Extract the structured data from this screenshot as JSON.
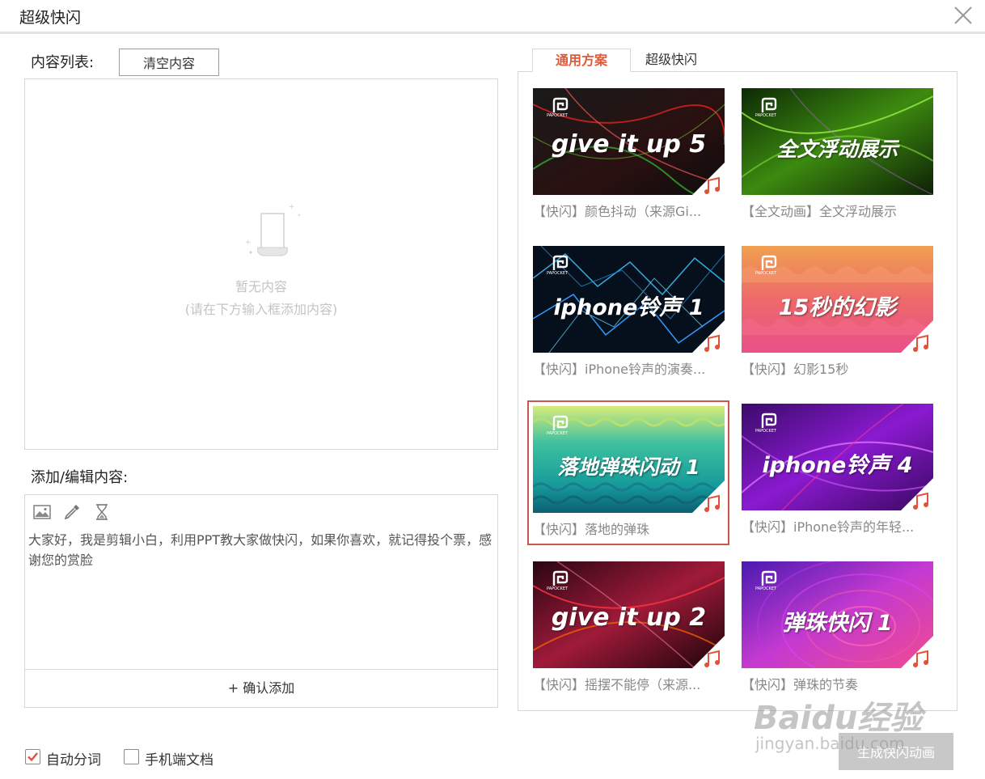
{
  "window": {
    "title": "超级快闪"
  },
  "content_list": {
    "label": "内容列表:",
    "clear_button": "清空内容",
    "empty_title": "暂无内容",
    "empty_hint": "(请在下方输入框添加内容)"
  },
  "editor": {
    "label": "添加/编辑内容:",
    "text": "大家好，我是剪辑小白，利用PPT教大家做快闪，如果你喜欢，就记得投个票，感谢您的赏脸",
    "confirm_button": "+ 确认添加",
    "tools": [
      "image-icon",
      "eyedropper-icon",
      "hourglass-icon"
    ]
  },
  "options": {
    "auto_segment": {
      "label": "自动分词",
      "checked": true
    },
    "mobile_doc": {
      "label": "手机端文档",
      "checked": false
    }
  },
  "tabs": [
    {
      "label": "通用方案",
      "active": true
    },
    {
      "label": "超级快闪",
      "active": false
    }
  ],
  "schemes": [
    {
      "thumb_text": "give it up 5",
      "caption": "【快闪】颜色抖动（来源Gi...",
      "selected": false
    },
    {
      "thumb_text": "全文浮动展示",
      "caption": "【全文动画】全文浮动展示",
      "selected": false
    },
    {
      "thumb_text": "iphone铃声 1",
      "caption": "【快闪】iPhone铃声的演奏...",
      "selected": false
    },
    {
      "thumb_text": "15秒的幻影",
      "caption": "【快闪】幻影15秒",
      "selected": false
    },
    {
      "thumb_text": "落地弹珠闪动 1",
      "caption": "【快闪】落地的弹珠",
      "selected": true
    },
    {
      "thumb_text": "iphone铃声 4",
      "caption": "【快闪】iPhone铃声的年轻...",
      "selected": false
    },
    {
      "thumb_text": "give it up 2",
      "caption": "【快闪】摇摆不能停（来源...",
      "selected": false
    },
    {
      "thumb_text": "弹珠快闪 1",
      "caption": "【快闪】弹珠的节奏",
      "selected": false
    }
  ],
  "brand": {
    "thumb_logo_text": "PAPOCKET"
  },
  "generate_button": "生成快闪动画",
  "watermark": {
    "main": "Baidu经验",
    "sub": "jingyan.baidu.com"
  },
  "colors": {
    "accent": "#e05a3a",
    "selected_border": "#c9574c",
    "music_icon": "#e0533a"
  }
}
